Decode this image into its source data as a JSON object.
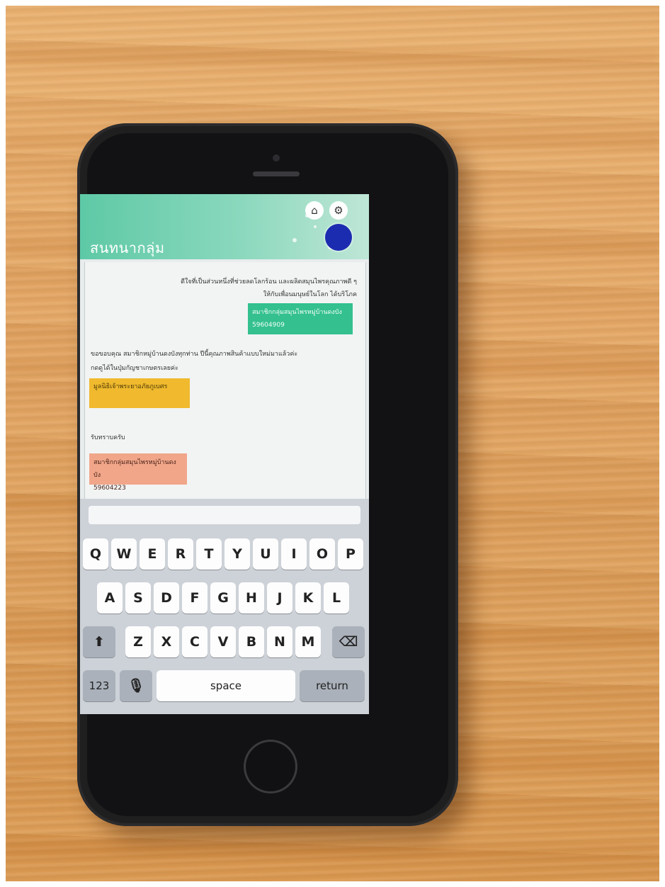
{
  "app": {
    "title": "สนทนากลุ่ม"
  },
  "header": {
    "home_icon": "home-icon",
    "settings_icon": "gear-icon"
  },
  "messages": [
    {
      "line1": "ดีใจที่เป็นส่วนหนึ่งที่ช่วยลดโลกร้อน และผลิตสมุนไพรคุณภาพดี ๆ",
      "line2": "ให้กับเพื่อนมนุษย์ในโลก ได้บริโภค",
      "sender_name": "สมาชิกกลุ่มสมุนไพรหมู่บ้านดงบัง",
      "sender_id": "59604909"
    },
    {
      "line1": "ขอขอบคุณ สมาชิกหมู่บ้านดงบังทุกท่าน ปีนี้คุณภาพสินค้าแบบใหม่มาแล้วค่ะ",
      "line2": "กดดูได้ในปุ่มกัญชาเกษตรเลยค่ะ",
      "sender_name": "มูลนิธิเจ้าพระยาอภัยภูเบศร",
      "sender_id": ""
    },
    {
      "line1": "รับทราบครับ",
      "line2": "",
      "sender_name": "สมาชิกกลุ่มสมุนไพรหมู่บ้านดงบัง",
      "sender_id": "59604223"
    }
  ],
  "keyboard": {
    "row1": [
      "Q",
      "W",
      "E",
      "R",
      "T",
      "Y",
      "U",
      "I",
      "O",
      "P"
    ],
    "row2": [
      "A",
      "S",
      "D",
      "F",
      "G",
      "H",
      "J",
      "K",
      "L"
    ],
    "row3": [
      "Z",
      "X",
      "C",
      "V",
      "B",
      "N",
      "M"
    ],
    "numbers_label": "123",
    "space_label": "space",
    "return_label": "return",
    "shift_icon": "shift-icon",
    "mic_icon": "microphone-icon",
    "delete_icon": "backspace-icon"
  }
}
